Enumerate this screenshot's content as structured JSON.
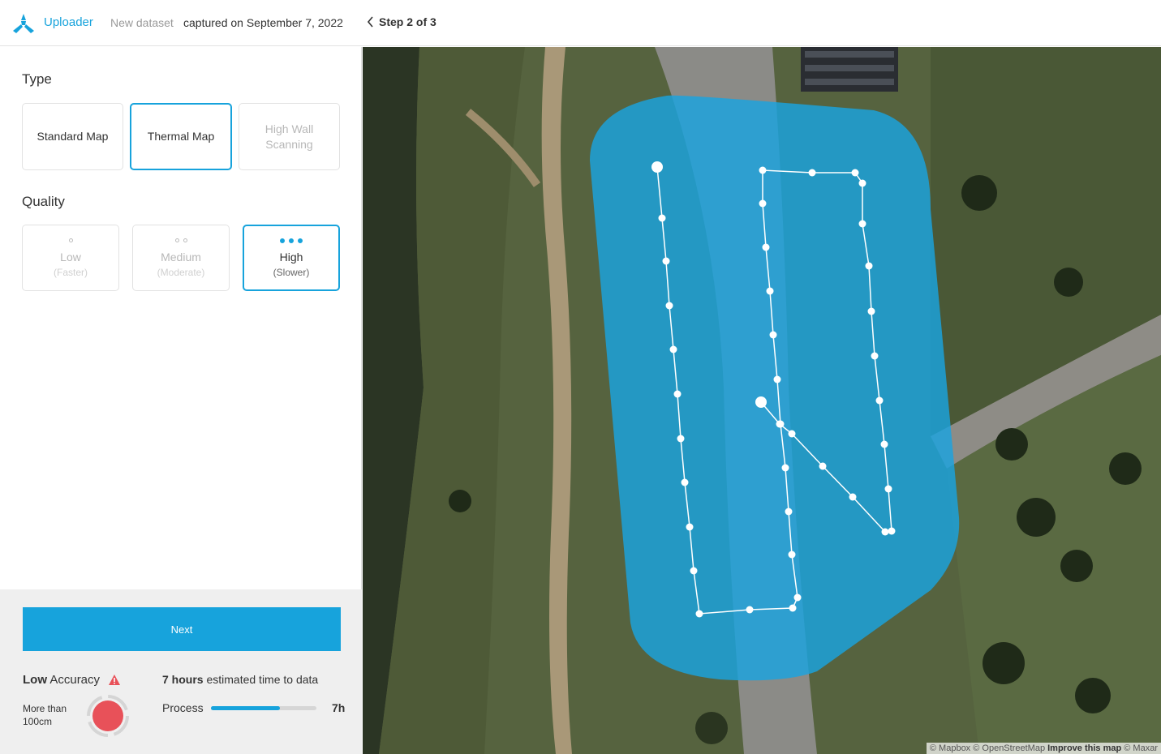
{
  "header": {
    "brand": "Uploader",
    "dataset": "New dataset",
    "captured": "captured on September 7, 2022",
    "step": "Step 2 of 3"
  },
  "type_section": {
    "title": "Type",
    "options": [
      {
        "label": "Standard Map",
        "state": "enabled"
      },
      {
        "label": "Thermal Map",
        "state": "selected"
      },
      {
        "label": "High Wall Scanning",
        "state": "disabled"
      }
    ]
  },
  "quality_section": {
    "title": "Quality",
    "options": [
      {
        "label": "Low",
        "sub": "(Faster)",
        "state": "disabled"
      },
      {
        "label": "Medium",
        "sub": "(Moderate)",
        "state": "disabled"
      },
      {
        "label": "High",
        "sub": "(Slower)",
        "state": "selected"
      }
    ]
  },
  "footer": {
    "next_label": "Next",
    "accuracy_level": "Low",
    "accuracy_word": "Accuracy",
    "accuracy_sub": "More than 100cm",
    "time_bold": "7 hours",
    "time_rest": "estimated time to data",
    "process_label": "Process",
    "process_value": "7h",
    "process_fraction": 0.65
  },
  "map": {
    "attribution_1": "© Mapbox © OpenStreetMap",
    "attribution_link": "Improve this map",
    "attribution_2": "© Maxar"
  },
  "colors": {
    "accent": "#17a3dc",
    "warning": "#e85159",
    "area_fill": "#1aa3e0"
  }
}
